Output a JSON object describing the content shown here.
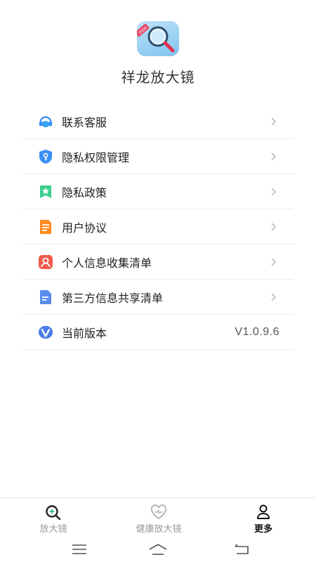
{
  "app": {
    "title": "祥龙放大镜",
    "icon_badge": "2024",
    "icon": "magnifier-app-icon"
  },
  "menu": {
    "items": [
      {
        "label": "联系客服",
        "icon": "customer-service-icon",
        "color": "#3a8ef6",
        "action": "chevron"
      },
      {
        "label": "隐私权限管理",
        "icon": "shield-key-icon",
        "color": "#3a8ef6",
        "action": "chevron"
      },
      {
        "label": "隐私政策",
        "icon": "bookmark-star-icon",
        "color": "#3ccf8e",
        "action": "chevron"
      },
      {
        "label": "用户协议",
        "icon": "document-icon",
        "color": "#ff8a1f",
        "action": "chevron"
      },
      {
        "label": "个人信息收集清单",
        "icon": "person-icon",
        "color": "#f25a4a",
        "action": "chevron"
      },
      {
        "label": "第三方信息共享清单",
        "icon": "file-icon",
        "color": "#5b8def",
        "action": "chevron"
      },
      {
        "label": "当前版本",
        "icon": "version-v-icon",
        "color": "#4a7de8",
        "value": "V1.0.9.6"
      }
    ]
  },
  "tabbar": {
    "tabs": [
      {
        "label": "放大镜",
        "icon": "magnifier-tab-icon",
        "active": false
      },
      {
        "label": "健康放大镜",
        "icon": "heart-tab-icon",
        "active": false
      },
      {
        "label": "更多",
        "icon": "person-tab-icon",
        "active": true
      }
    ]
  },
  "system_nav": {
    "buttons": [
      "menu-icon",
      "home-icon",
      "back-icon"
    ]
  }
}
